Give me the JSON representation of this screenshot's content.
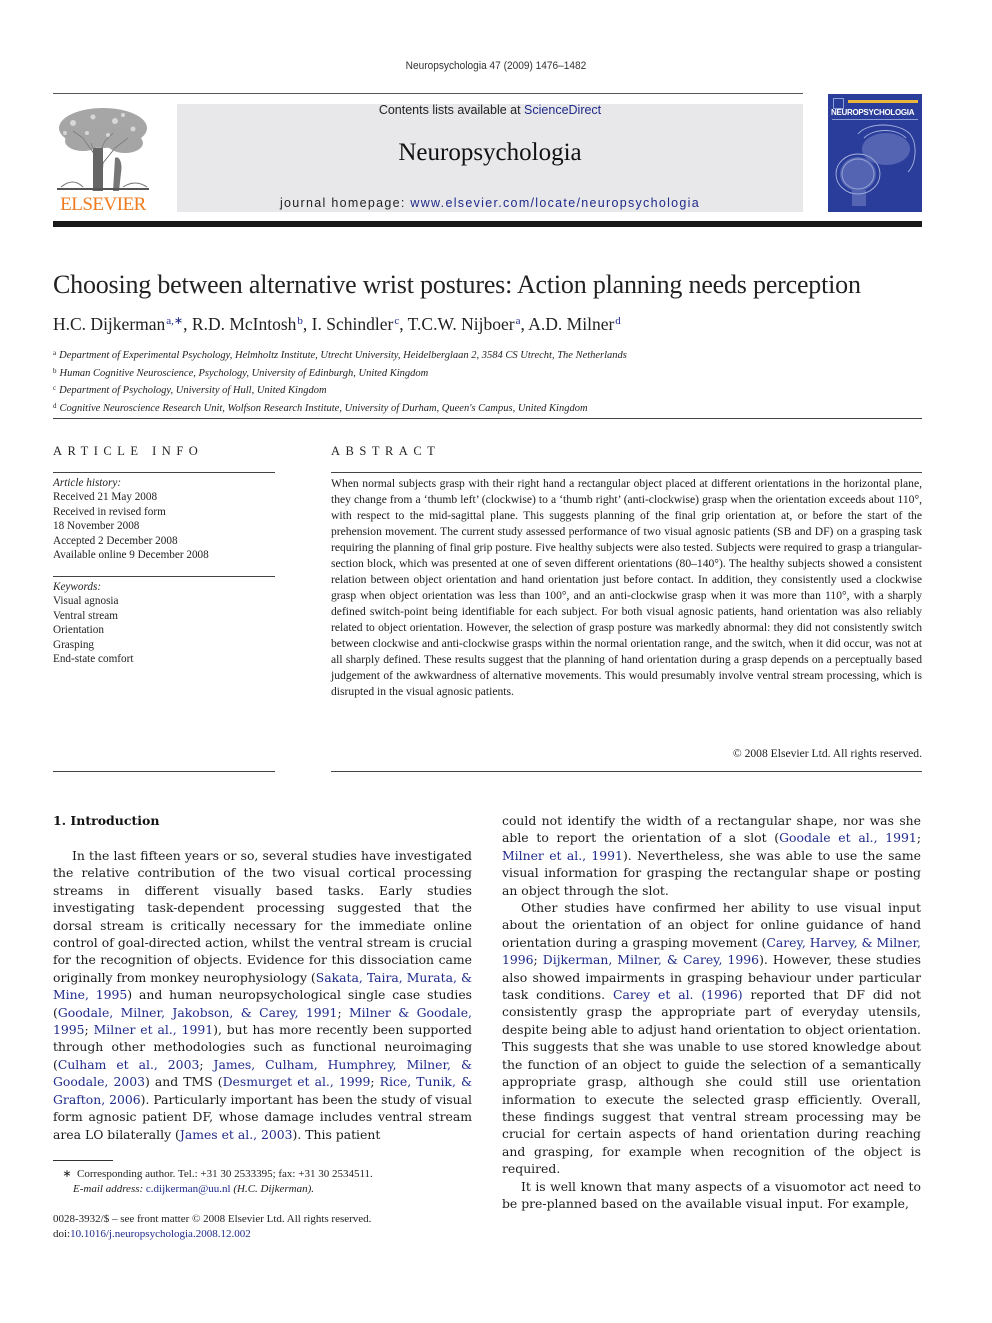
{
  "running_head": "Neuropsychologia 47 (2009) 1476–1482",
  "masthead": {
    "publisher_logo_text": "ELSEVIER",
    "contents_prefix": "Contents lists available at ",
    "contents_link": "ScienceDirect",
    "journal_name": "Neuropsychologia",
    "homepage_prefix": "journal homepage: ",
    "homepage_link": "www.elsevier.com/locate/neuropsychologia",
    "cover_title": "NEUROPSYCHOLOGIA"
  },
  "colors": {
    "link": "#1f2a8a",
    "elsevier_orange": "#f07b1f",
    "masthead_bg": "#e8e8ea",
    "cover_blue": "#2a3d9a",
    "cover_accent": "#e7b63a"
  },
  "article": {
    "title": "Choosing between alternative wrist postures: Action planning needs perception",
    "authors": [
      {
        "name": "H.C. Dijkerman",
        "sup": "a,∗",
        "sep": ", "
      },
      {
        "name": "R.D. McIntosh",
        "sup": "b",
        "sep": ", "
      },
      {
        "name": "I. Schindler",
        "sup": "c",
        "sep": ", "
      },
      {
        "name": "T.C.W. Nijboer",
        "sup": "a",
        "sep": ", "
      },
      {
        "name": "A.D. Milner",
        "sup": "d",
        "sep": ""
      }
    ],
    "affiliations": [
      {
        "mark": "a",
        "text": "Department of Experimental Psychology, Helmholtz Institute, Utrecht University, Heidelberglaan 2, 3584 CS Utrecht, The Netherlands"
      },
      {
        "mark": "b",
        "text": "Human Cognitive Neuroscience, Psychology, University of Edinburgh, United Kingdom"
      },
      {
        "mark": "c",
        "text": "Department of Psychology, University of Hull, United Kingdom"
      },
      {
        "mark": "d",
        "text": "Cognitive Neuroscience Research Unit, Wolfson Research Institute, University of Durham, Queen's Campus, United Kingdom"
      }
    ]
  },
  "article_info": {
    "heading": "ARTICLE INFO",
    "history_label": "Article history:",
    "history": [
      "Received 21 May 2008",
      "Received in revised form",
      "18 November 2008",
      "Accepted 2 December 2008",
      "Available online 9 December 2008"
    ],
    "keywords_label": "Keywords:",
    "keywords": [
      "Visual agnosia",
      "Ventral stream",
      "Orientation",
      "Grasping",
      "End-state comfort"
    ]
  },
  "abstract": {
    "heading": "ABSTRACT",
    "text": "When normal subjects grasp with their right hand a rectangular object placed at different orientations in the horizontal plane, they change from a ‘thumb left’ (clockwise) to a ‘thumb right’ (anti-clockwise) grasp when the orientation exceeds about 110°, with respect to the mid-sagittal plane. This suggests planning of the final grip orientation at, or before the start of the prehension movement. The current study assessed performance of two visual agnosic patients (SB and DF) on a grasping task requiring the planning of final grip posture. Five healthy subjects were also tested. Subjects were required to grasp a triangular-section block, which was presented at one of seven different orientations (80–140°). The healthy subjects showed a consistent relation between object orientation and hand orientation just before contact. In addition, they consistently used a clockwise grasp when object orientation was less than 100°, and an anti-clockwise grasp when it was more than 110°, with a sharply defined switch-point being identifiable for each subject. For both visual agnosic patients, hand orientation was also reliably related to object orientation. However, the selection of grasp posture was markedly abnormal: they did not consistently switch between clockwise and anti-clockwise grasps within the normal orientation range, and the switch, when it did occur, was not at all sharply defined. These results suggest that the planning of hand orientation during a grasp depends on a perceptually based judgement of the awkwardness of alternative movements. This would presumably involve ventral stream processing, which is disrupted in the visual agnosic patients.",
    "copyright": "© 2008 Elsevier Ltd. All rights reserved."
  },
  "introduction": {
    "heading": "1.  Introduction",
    "left_col": [
      [
        {
          "t": "In the last fifteen years or so, several studies have investigated the relative contribution of the two visual cortical processing streams in different visually based tasks. Early studies investigating task-dependent processing suggested that the dorsal stream is critically necessary for the immediate online control of goal-directed action, whilst the ventral stream is crucial for the recognition of objects. Evidence for this dissociation came originally from monkey neurophysiology ("
        },
        {
          "l": "Sakata, Taira, Murata, & Mine, 1995"
        },
        {
          "t": ") and human neuropsychological single case studies ("
        },
        {
          "l": "Goodale, Milner, Jakobson, & Carey, 1991"
        },
        {
          "t": "; "
        },
        {
          "l": "Milner & Goodale, 1995"
        },
        {
          "t": "; "
        },
        {
          "l": "Milner et al., 1991"
        },
        {
          "t": "), but has more recently been supported through other methodologies such as functional neuroimaging ("
        },
        {
          "l": "Culham et al., 2003"
        },
        {
          "t": "; "
        },
        {
          "l": "James, Culham, Humphrey, Milner, & Goodale, 2003"
        },
        {
          "t": ") and TMS ("
        },
        {
          "l": "Desmurget et al., 1999"
        },
        {
          "t": "; "
        },
        {
          "l": "Rice, Tunik, & Grafton, 2006"
        },
        {
          "t": "). Particularly important has been the study of visual form agnosic patient DF, whose damage includes ventral stream area LO bilaterally ("
        },
        {
          "l": "James et al., 2003"
        },
        {
          "t": "). This patient"
        }
      ]
    ],
    "right_col": [
      [
        {
          "t": "could not identify the width of a rectangular shape, nor was she able to report the orientation of a slot ("
        },
        {
          "l": "Goodale et al., 1991"
        },
        {
          "t": "; "
        },
        {
          "l": "Milner et al., 1991"
        },
        {
          "t": "). Nevertheless, she was able to use the same visual information for grasping the rectangular shape or posting an object through the slot."
        }
      ],
      [
        {
          "t": "Other studies have confirmed her ability to use visual input about the orientation of an object for online guidance of hand orientation during a grasping movement ("
        },
        {
          "l": "Carey, Harvey, & Milner, 1996"
        },
        {
          "t": "; "
        },
        {
          "l": "Dijkerman, Milner, & Carey, 1996"
        },
        {
          "t": "). However, these studies also showed impairments in grasping behaviour under particular task conditions. "
        },
        {
          "l": "Carey et al. (1996)"
        },
        {
          "t": " reported that DF did not consistently grasp the appropriate part of everyday utensils, despite being able to adjust hand orientation to object orientation. This suggests that she was unable to use stored knowledge about the function of an object to guide the selection of a semantically appropriate grasp, although she could still use orientation information to execute the selected grasp efficiently. Overall, these findings suggest that ventral stream processing may be crucial for certain aspects of hand orientation during reaching and grasping, for example when recognition of the object is required."
        }
      ],
      [
        {
          "t": "It is well known that many aspects of a visuomotor act need to be pre-planned based on the available visual input. For example,"
        }
      ]
    ]
  },
  "footnote": {
    "star": "∗",
    "corresponding": "Corresponding author. Tel.: +31 30 2533395; fax: +31 30 2534511.",
    "email_label": "E-mail address: ",
    "email": "c.dijkerman@uu.nl",
    "email_suffix": " (H.C. Dijkerman)."
  },
  "front_matter": {
    "issn_line": "0028-3932/$ – see front matter © 2008 Elsevier Ltd. All rights reserved.",
    "doi_prefix": "doi:",
    "doi": "10.1016/j.neuropsychologia.2008.12.002"
  }
}
